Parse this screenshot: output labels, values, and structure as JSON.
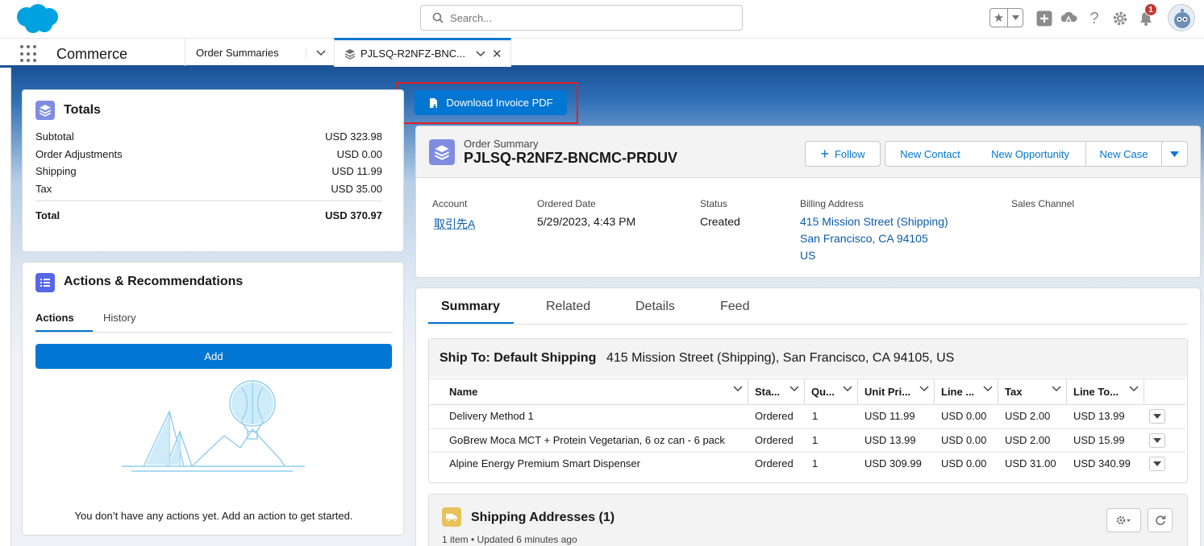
{
  "header": {
    "search_placeholder": "Search...",
    "notification_count": "1"
  },
  "nav": {
    "app_name": "Commerce",
    "tabs": [
      {
        "label": "Order Summaries"
      },
      {
        "label": "PJLSQ-R2NFZ-BNC..."
      }
    ]
  },
  "action_button": {
    "label": "Download Invoice PDF"
  },
  "totals": {
    "title": "Totals",
    "rows": [
      {
        "label": "Subtotal",
        "value": "USD 323.98"
      },
      {
        "label": "Order Adjustments",
        "value": "USD 0.00"
      },
      {
        "label": "Shipping",
        "value": "USD 11.99"
      },
      {
        "label": "Tax",
        "value": "USD 35.00"
      }
    ],
    "total_label": "Total",
    "total_value": "USD 370.97"
  },
  "actions_card": {
    "title": "Actions & Recommendations",
    "tabs": [
      "Actions",
      "History"
    ],
    "add_label": "Add",
    "empty_text": "You don’t have any actions yet. Add an action to get started."
  },
  "record": {
    "object_label": "Order Summary",
    "name": "PJLSQ-R2NFZ-BNCMC-PRDUV",
    "buttons": {
      "follow": "Follow",
      "new_contact": "New Contact",
      "new_opportunity": "New Opportunity",
      "new_case": "New Case"
    },
    "fields": {
      "account_label": "Account",
      "account_value": "取引先A",
      "ordered_date_label": "Ordered Date",
      "ordered_date_value": "5/29/2023, 4:43 PM",
      "status_label": "Status",
      "status_value": "Created",
      "billing_label": "Billing Address",
      "billing_line1": "415 Mission Street (Shipping)",
      "billing_line2": "San Francisco, CA 94105",
      "billing_line3": "US",
      "sales_channel_label": "Sales Channel"
    }
  },
  "detail_tabs": [
    "Summary",
    "Related",
    "Details",
    "Feed"
  ],
  "ship_to": {
    "label": "Ship To: Default Shipping",
    "address": "415 Mission Street (Shipping), San Francisco, CA  94105, US"
  },
  "table": {
    "columns": [
      "Name",
      "Sta...",
      "Qu...",
      "Unit Pri...",
      "Line ...",
      "Tax",
      "Line To..."
    ],
    "rows": [
      {
        "name": "Delivery Method 1",
        "status": "Ordered",
        "qty": "1",
        "unit": "USD 11.99",
        "line": "USD 0.00",
        "tax": "USD 2.00",
        "total": "USD 13.99"
      },
      {
        "name": "GoBrew Moca MCT + Protein Vegetarian, 6 oz can - 6 pack",
        "status": "Ordered",
        "qty": "1",
        "unit": "USD 13.99",
        "line": "USD 0.00",
        "tax": "USD 2.00",
        "total": "USD 15.99"
      },
      {
        "name": "Alpine Energy Premium Smart Dispenser",
        "status": "Ordered",
        "qty": "1",
        "unit": "USD 309.99",
        "line": "USD 0.00",
        "tax": "USD 31.00",
        "total": "USD 340.99"
      }
    ]
  },
  "shipping_addresses": {
    "title": "Shipping Addresses (1)",
    "meta": "1 item • Updated 6 minutes ago"
  },
  "colors": {
    "brand_blue": "#0176d3",
    "link": "#0b5cab",
    "highlight_red": "#e02020"
  }
}
